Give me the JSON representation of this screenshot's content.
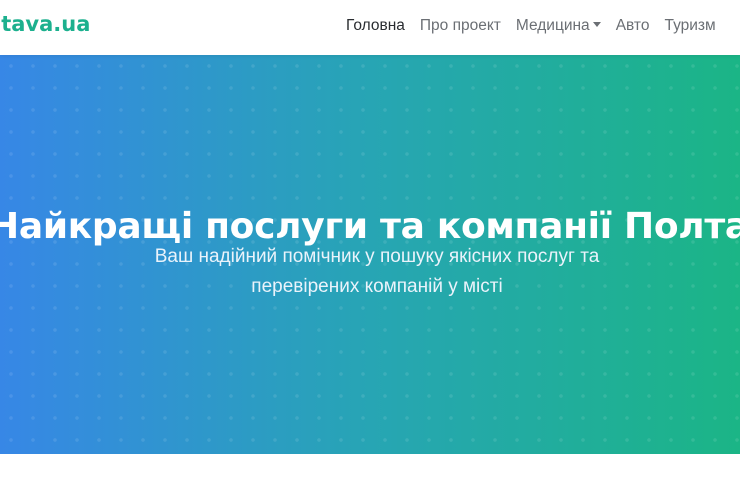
{
  "header": {
    "brand": "ltava.ua",
    "nav": [
      {
        "label": "Головна",
        "active": true
      },
      {
        "label": "Про проект",
        "active": false
      },
      {
        "label": "Медицина",
        "active": false,
        "dropdown": true
      },
      {
        "label": "Авто",
        "active": false
      },
      {
        "label": "Туризм",
        "active": false
      }
    ]
  },
  "hero": {
    "title": "Найкращі послуги та компанії Полтав",
    "subtitle_line1": "Ваш надійний помічник у пошуку якісних послуг та",
    "subtitle_line2": "перевірених компаній у місті"
  },
  "colors": {
    "brand": "#1cb08e",
    "gradient_start": "#3787e6",
    "gradient_end": "#1bb586"
  }
}
